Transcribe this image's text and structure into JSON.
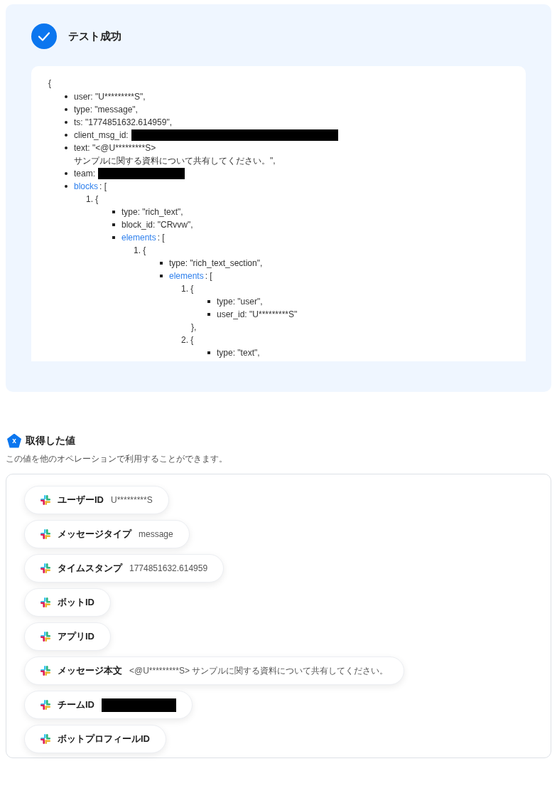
{
  "result": {
    "title": "テスト成功",
    "open": "{",
    "fields": [
      {
        "kind": "field",
        "key": "user:",
        "value": "\"U*********S\","
      },
      {
        "kind": "field",
        "key": "type:",
        "value": "\"message\","
      },
      {
        "kind": "field",
        "key": "ts:",
        "value": "\"1774851632.614959\","
      },
      {
        "kind": "redacted",
        "key": "client_msg_id:"
      },
      {
        "kind": "field",
        "key": "text:",
        "value": "\"<@U*********S>\nサンプルに関する資料について共有してください。\","
      },
      {
        "kind": "redacted",
        "key": "team:"
      },
      {
        "kind": "list",
        "key": "blocks",
        "bracket": ": [",
        "items": [
          {
            "number": "1.",
            "brace": "{",
            "fields": [
              {
                "kind": "field",
                "key": "type:",
                "value": "\"rich_text\","
              },
              {
                "kind": "field",
                "key": "block_id:",
                "value": "\"CRvvw\","
              },
              {
                "kind": "list",
                "key": "elements",
                "bracket": ": [",
                "items": [
                  {
                    "number": "1.",
                    "brace": "{",
                    "fields": [
                      {
                        "kind": "field",
                        "key": "type:",
                        "value": "\"rich_text_section\","
                      },
                      {
                        "kind": "list",
                        "key": "elements",
                        "bracket": ": [",
                        "items": [
                          {
                            "number": "1.",
                            "brace": "{",
                            "fields": [
                              {
                                "kind": "field",
                                "key": "type:",
                                "value": "\"user\","
                              },
                              {
                                "kind": "field",
                                "key": "user_id:",
                                "value": "\"U*********S\""
                              }
                            ],
                            "close": "},"
                          },
                          {
                            "number": "2.",
                            "brace": "{",
                            "fields": [
                              {
                                "kind": "field",
                                "key": "type:",
                                "value": "\"text\","
                              }
                            ]
                          }
                        ]
                      }
                    ]
                  }
                ]
              }
            ]
          }
        ]
      }
    ]
  },
  "values": {
    "title": "取得した値",
    "badge": "x",
    "description": "この値を他のオペレーションで利用することができます。",
    "chips": [
      {
        "label": "ユーザーID",
        "value": "U*********S"
      },
      {
        "label": "メッセージタイプ",
        "value": "message"
      },
      {
        "label": "タイムスタンプ",
        "value": "1774851632.614959"
      },
      {
        "label": "ボットID"
      },
      {
        "label": "アプリID"
      },
      {
        "label": "メッセージ本文",
        "value": "<@U*********S> サンプルに関する資料について共有してください。"
      },
      {
        "label": "チームID",
        "redacted": true
      },
      {
        "label": "ボットプロフィールID"
      }
    ]
  }
}
